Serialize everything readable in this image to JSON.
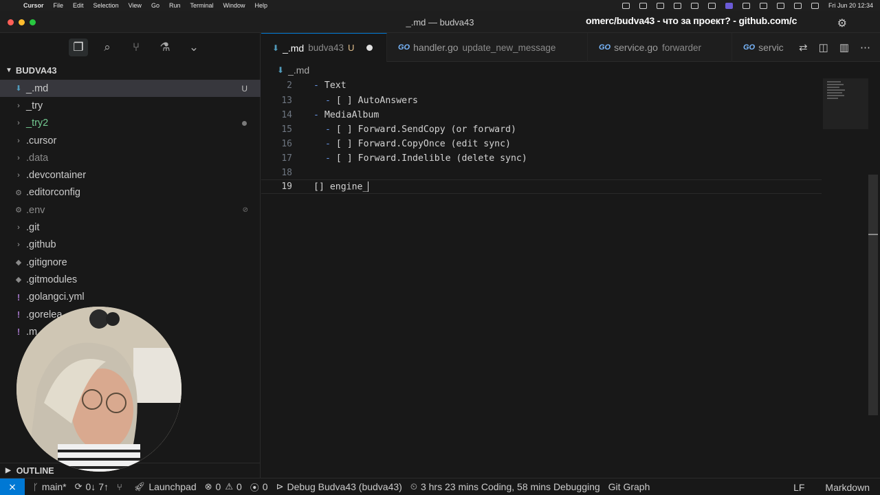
{
  "menubar": {
    "app": "Cursor",
    "items": [
      "File",
      "Edit",
      "Selection",
      "View",
      "Go",
      "Run",
      "Terminal",
      "Window",
      "Help"
    ],
    "clock": "Fri Jun 20  12:34"
  },
  "window": {
    "title": "_.md — budva43",
    "overlay_title": "omerc/budva43 - что за проект? - github.com/c"
  },
  "sidebar": {
    "explorer_title": "BUDVA43",
    "items": [
      {
        "name": "_.md",
        "kind": "md",
        "status": "U",
        "selected": true
      },
      {
        "name": "_try",
        "kind": "folder"
      },
      {
        "name": "_try2",
        "kind": "folder",
        "color": "green",
        "dot": true
      },
      {
        "name": ".cursor",
        "kind": "folder"
      },
      {
        "name": ".data",
        "kind": "folder",
        "color": "dim"
      },
      {
        "name": ".devcontainer",
        "kind": "folder"
      },
      {
        "name": ".editorconfig",
        "kind": "config"
      },
      {
        "name": ".env",
        "kind": "config",
        "color": "dim",
        "ignored": true
      },
      {
        "name": ".git",
        "kind": "folder"
      },
      {
        "name": ".github",
        "kind": "folder"
      },
      {
        "name": ".gitignore",
        "kind": "git"
      },
      {
        "name": ".gitmodules",
        "kind": "git"
      },
      {
        "name": ".golangci.yml",
        "kind": "yaml"
      },
      {
        "name": ".gorelea",
        "kind": "yaml"
      },
      {
        "name": ".m",
        "kind": "yaml"
      }
    ],
    "outline_label": "OUTLINE"
  },
  "tabs": [
    {
      "label": "_.md",
      "desc": "budva43",
      "status": "U",
      "modified": true,
      "kind": "md",
      "active": true
    },
    {
      "label": "handler.go",
      "desc": "update_new_message",
      "kind": "go"
    },
    {
      "label": "service.go",
      "desc": "forwarder",
      "kind": "go"
    },
    {
      "label": "servic",
      "desc": "",
      "kind": "go"
    }
  ],
  "breadcrumb": {
    "file": "_.md"
  },
  "editor": {
    "lines": [
      {
        "num": "2",
        "indent": 0,
        "dash": true,
        "text": "Text"
      },
      {
        "num": "13",
        "indent": 1,
        "dash": true,
        "text": "[ ] AutoAnswers"
      },
      {
        "num": "14",
        "indent": 0,
        "dash": true,
        "text": "MediaAlbum"
      },
      {
        "num": "15",
        "indent": 1,
        "dash": true,
        "text": "[ ] Forward.SendCopy (or forward)"
      },
      {
        "num": "16",
        "indent": 1,
        "dash": true,
        "text": "[ ] Forward.CopyOnce (edit sync)"
      },
      {
        "num": "17",
        "indent": 1,
        "dash": true,
        "text": "[ ] Forward.Indelible (delete sync)"
      },
      {
        "num": "18",
        "indent": 0,
        "dash": false,
        "text": ""
      },
      {
        "num": "19",
        "indent": 0,
        "dash": false,
        "text": "[] engine_",
        "current": true
      }
    ]
  },
  "statusbar": {
    "branch": "main*",
    "sync": "0↓ 7↑",
    "launchpad": "Launchpad",
    "errors": "0",
    "warnings": "0",
    "ports": "0",
    "debug": "Debug Budva43 (budva43)",
    "time_tracking": "3 hrs 23 mins Coding, 58 mins Debugging",
    "git_graph": "Git Graph",
    "eol": "LF",
    "language": "Markdown"
  }
}
